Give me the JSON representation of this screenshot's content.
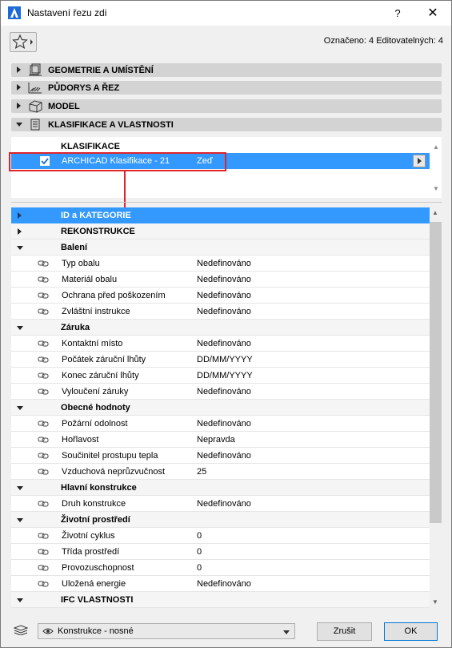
{
  "window": {
    "title": "Nastavení řezu zdi",
    "help_label": "?",
    "close_label": "✕"
  },
  "toolbar": {
    "selected_info": "Označeno: 4 Editovatelných: 4"
  },
  "panels": [
    {
      "label": "GEOMETRIE A UMÍSTĚNÍ",
      "icon": "geometry-icon",
      "expanded": false
    },
    {
      "label": "PŮDORYS A ŘEZ",
      "icon": "floorplan-icon",
      "expanded": false
    },
    {
      "label": "MODEL",
      "icon": "model-icon",
      "expanded": false
    },
    {
      "label": "KLASIFIKACE A VLASTNOSTI",
      "icon": "classification-icon",
      "expanded": true
    }
  ],
  "classification": {
    "header": "KLASIFIKACE",
    "system": "ARCHICAD Klasifikace - 21",
    "value": "Zeď",
    "checked": true,
    "highlight_color": "#e0242b"
  },
  "tree": {
    "rows": [
      {
        "type": "group",
        "label": "ID a KATEGORIE",
        "expanded": false,
        "selected": true
      },
      {
        "type": "group",
        "label": "REKONSTRUKCE",
        "expanded": false
      },
      {
        "type": "group",
        "label": "Balení",
        "expanded": true
      },
      {
        "type": "prop",
        "name": "Typ obalu",
        "value": "Nedefinováno"
      },
      {
        "type": "prop",
        "name": "Materiál obalu",
        "value": "Nedefinováno"
      },
      {
        "type": "prop",
        "name": "Ochrana před poškozením",
        "value": "Nedefinováno"
      },
      {
        "type": "prop",
        "name": "Zvláštní instrukce",
        "value": "Nedefinováno"
      },
      {
        "type": "group",
        "label": "Záruka",
        "expanded": true
      },
      {
        "type": "prop",
        "name": "Kontaktní místo",
        "value": "Nedefinováno"
      },
      {
        "type": "prop",
        "name": "Počátek záruční lhůty",
        "value": "DD/MM/YYYY"
      },
      {
        "type": "prop",
        "name": "Konec záruční lhůty",
        "value": "DD/MM/YYYY"
      },
      {
        "type": "prop",
        "name": "Vyloučení záruky",
        "value": "Nedefinováno"
      },
      {
        "type": "group",
        "label": "Obecné hodnoty",
        "expanded": true
      },
      {
        "type": "prop",
        "name": "Požární odolnost",
        "value": "Nedefinováno"
      },
      {
        "type": "prop",
        "name": "Hořlavost",
        "value": "Nepravda"
      },
      {
        "type": "prop",
        "name": "Součinitel prostupu tepla",
        "value": "Nedefinováno"
      },
      {
        "type": "prop",
        "name": "Vzduchová neprůzvučnost",
        "value": "25"
      },
      {
        "type": "group",
        "label": "Hlavní konstrukce",
        "expanded": true
      },
      {
        "type": "prop",
        "name": "Druh konstrukce",
        "value": "Nedefinováno"
      },
      {
        "type": "group",
        "label": "Životní prostředí",
        "expanded": true
      },
      {
        "type": "prop",
        "name": "Životní cyklus",
        "value": "0"
      },
      {
        "type": "prop",
        "name": "Třída prostředí",
        "value": "0"
      },
      {
        "type": "prop",
        "name": "Provozuschopnost",
        "value": "0"
      },
      {
        "type": "prop",
        "name": "Uložená energie",
        "value": "Nedefinováno"
      },
      {
        "type": "group",
        "label": "IFC VLASTNOSTI",
        "expanded": true
      }
    ]
  },
  "footer": {
    "layer": "Konstrukce - nosné",
    "cancel_label": "Zrušit",
    "ok_label": "OK"
  },
  "colors": {
    "selection": "#3399ff",
    "panel_header": "#d3d3d3",
    "annotation_red": "#e0242b"
  }
}
